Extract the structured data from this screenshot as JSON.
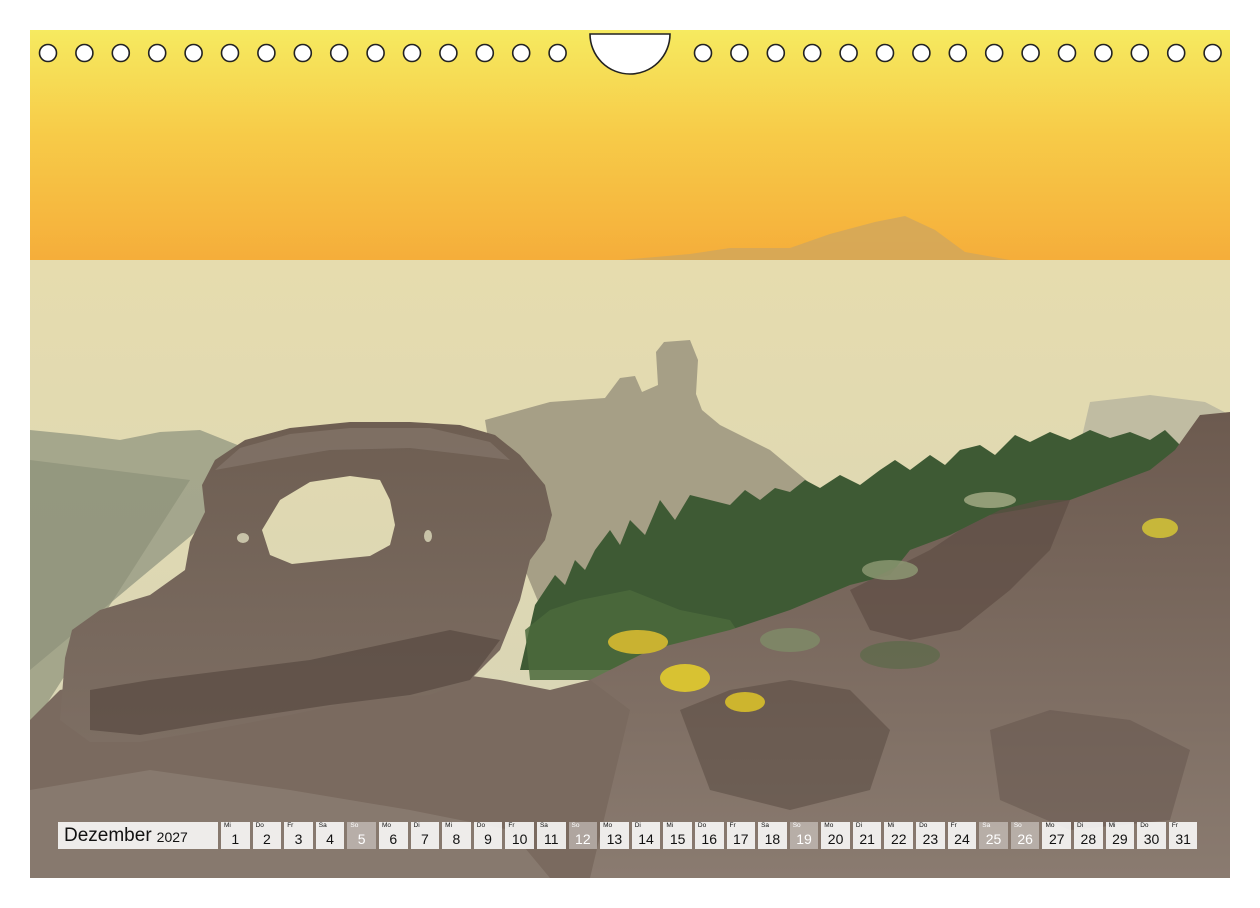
{
  "calendar": {
    "month": "Dezember",
    "year": "2027",
    "days": [
      {
        "wd": "Mi",
        "n": "1",
        "we": false
      },
      {
        "wd": "Do",
        "n": "2",
        "we": false
      },
      {
        "wd": "Fr",
        "n": "3",
        "we": false
      },
      {
        "wd": "Sa",
        "n": "4",
        "we": false
      },
      {
        "wd": "So",
        "n": "5",
        "we": true
      },
      {
        "wd": "Mo",
        "n": "6",
        "we": false
      },
      {
        "wd": "Di",
        "n": "7",
        "we": false
      },
      {
        "wd": "Mi",
        "n": "8",
        "we": false
      },
      {
        "wd": "Do",
        "n": "9",
        "we": false
      },
      {
        "wd": "Fr",
        "n": "10",
        "we": false
      },
      {
        "wd": "Sa",
        "n": "11",
        "we": false
      },
      {
        "wd": "So",
        "n": "12",
        "we": true
      },
      {
        "wd": "Mo",
        "n": "13",
        "we": false
      },
      {
        "wd": "Di",
        "n": "14",
        "we": false
      },
      {
        "wd": "Mi",
        "n": "15",
        "we": false
      },
      {
        "wd": "Do",
        "n": "16",
        "we": false
      },
      {
        "wd": "Fr",
        "n": "17",
        "we": false
      },
      {
        "wd": "Sa",
        "n": "18",
        "we": false
      },
      {
        "wd": "So",
        "n": "19",
        "we": true
      },
      {
        "wd": "Mo",
        "n": "20",
        "we": false
      },
      {
        "wd": "Di",
        "n": "21",
        "we": false
      },
      {
        "wd": "Mi",
        "n": "22",
        "we": false
      },
      {
        "wd": "Do",
        "n": "23",
        "we": false
      },
      {
        "wd": "Fr",
        "n": "24",
        "we": false
      },
      {
        "wd": "Sa",
        "n": "25",
        "we": true
      },
      {
        "wd": "So",
        "n": "26",
        "we": true
      },
      {
        "wd": "Mo",
        "n": "27",
        "we": false
      },
      {
        "wd": "Di",
        "n": "28",
        "we": false
      },
      {
        "wd": "Mi",
        "n": "29",
        "we": false
      },
      {
        "wd": "Do",
        "n": "30",
        "we": false
      },
      {
        "wd": "Fr",
        "n": "31",
        "we": false
      }
    ]
  },
  "colors": {
    "sky_top": "#f6ea5e",
    "sky_horizon": "#f7b43a",
    "haze": "#ddd7b4",
    "rock": "#6a5a50",
    "pine": "#3e5a34",
    "gorse": "#d8c232",
    "weekend_cell": "#d9d9d9"
  }
}
